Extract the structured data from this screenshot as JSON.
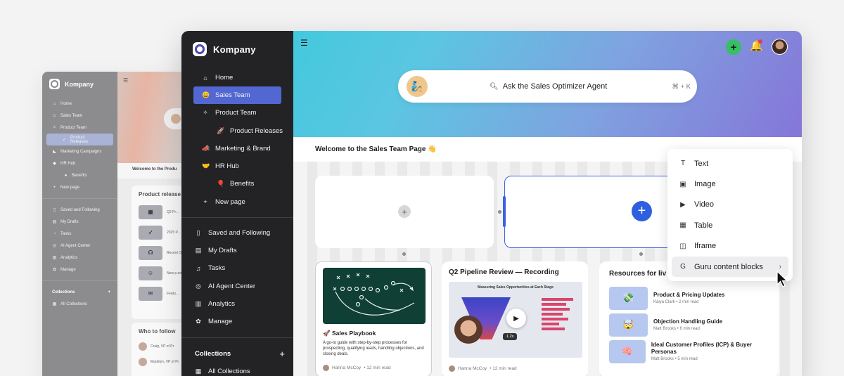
{
  "bg_window": {
    "brand": "Kompany",
    "nav": [
      {
        "icon": "⌂",
        "label": "Home",
        "sub": false,
        "active": false
      },
      {
        "icon": "☺",
        "label": "Sales Team",
        "sub": false,
        "active": false
      },
      {
        "icon": "✧",
        "label": "Product Team",
        "sub": false,
        "active": false
      },
      {
        "icon": "➶",
        "label": "Product Releases",
        "sub": true,
        "active": true
      },
      {
        "icon": "◣",
        "label": "Marketing Campaigns",
        "sub": false,
        "active": false
      },
      {
        "icon": "◆",
        "label": "HR Hub",
        "sub": false,
        "active": false
      },
      {
        "icon": "●",
        "label": "Benefits",
        "sub": true,
        "active": false
      },
      {
        "icon": "+",
        "label": "New page",
        "sub": false,
        "active": false
      }
    ],
    "nav2": [
      {
        "icon": "▯",
        "label": "Saved and Following"
      },
      {
        "icon": "▤",
        "label": "My Drafts"
      },
      {
        "icon": "◔",
        "label": "Tasks"
      },
      {
        "icon": "◎",
        "label": "AI Agent Center"
      },
      {
        "icon": "▥",
        "label": "Analytics"
      },
      {
        "icon": "✿",
        "label": "Manage"
      }
    ],
    "collections_label": "Collections",
    "all_collections": "All Collections",
    "welcome": "Welcome to the Produ",
    "card_title": "Product release",
    "card_rows": [
      {
        "icon": "▦",
        "text": "Q2 Pr..."
      },
      {
        "icon": "➶",
        "text": "2025 P..."
      },
      {
        "icon": "☊",
        "text": "Recent Overvie..."
      },
      {
        "icon": "☺",
        "text": "New p articl..."
      },
      {
        "icon": "✉",
        "text": "Featu..."
      }
    ],
    "follow_title": "Who to follow",
    "people": [
      {
        "name": "Craig,",
        "role": "VP of Pr"
      },
      {
        "name": "Madelyn,",
        "role": "VP of Pr"
      }
    ]
  },
  "sidebar": {
    "brand": "Kompany",
    "nav": [
      {
        "icon": "⌂",
        "label": "Home",
        "sub": false,
        "active": false
      },
      {
        "icon": "😀",
        "label": "Sales Team",
        "sub": false,
        "active": true
      },
      {
        "icon": "✧",
        "label": "Product Team",
        "sub": false,
        "active": false
      },
      {
        "icon": "🚀",
        "label": "Product Releases",
        "sub": true,
        "active": false
      },
      {
        "icon": "📣",
        "label": "Marketing & Brand",
        "sub": false,
        "active": false
      },
      {
        "icon": "🤝",
        "label": "HR Hub",
        "sub": false,
        "active": false
      },
      {
        "icon": "🎈",
        "label": "Benefits",
        "sub": true,
        "active": false
      },
      {
        "icon": "+",
        "label": "New page",
        "sub": false,
        "active": false
      }
    ],
    "nav2": [
      {
        "icon": "▯",
        "label": "Saved and Following"
      },
      {
        "icon": "▤",
        "label": "My Drafts"
      },
      {
        "icon": "♫",
        "label": "Tasks"
      },
      {
        "icon": "◎",
        "label": "AI Agent Center"
      },
      {
        "icon": "▥",
        "label": "Analytics"
      },
      {
        "icon": "✿",
        "label": "Manage"
      }
    ],
    "collections_label": "Collections",
    "all_collections": "All Collections"
  },
  "header": {
    "search_placeholder": "Ask the Sales Optimizer Agent",
    "shortcut": "⌘ + K",
    "accent_color": "#2d5fe0"
  },
  "page": {
    "welcome": "Welcome to the Sales Team Page 👋"
  },
  "cards": {
    "playbook": {
      "title": "🚀 Sales Playbook",
      "desc": "A go-to guide with step-by-step processes for prospecting, qualifying leads, handling objections, and closing deals.",
      "author": "Hanna McCoy",
      "read": "• 12 min read"
    },
    "pipeline": {
      "title": "Q2 Pipeline Review — Recording",
      "video_heading": "Measuring Sales Opportunities at Each Stage",
      "speed": "1.2x",
      "author": "Hanna McCoy",
      "read": "• 12 min read"
    },
    "resources": {
      "title": "Resources for liv",
      "items": [
        {
          "icon": "💸",
          "title": "Product & Pricing Updates",
          "meta": "Kaiya Clark • 2 min read"
        },
        {
          "icon": "🤯",
          "title": "Objection Handling Guide",
          "meta": "Matt Brooks • 6 min read"
        },
        {
          "icon": "🧠",
          "title": "Ideal Customer Profiles (ICP) & Buyer Personas",
          "meta": "Matt Brooks • 5 min read"
        }
      ]
    }
  },
  "insert_menu": {
    "items": [
      {
        "icon": "T",
        "label": "Text",
        "name": "text"
      },
      {
        "icon": "▣",
        "label": "Image",
        "name": "image"
      },
      {
        "icon": "▶",
        "label": "Video",
        "name": "video"
      },
      {
        "icon": "▦",
        "label": "Table",
        "name": "table"
      },
      {
        "icon": "◫",
        "label": "Iframe",
        "name": "iframe"
      },
      {
        "icon": "G",
        "label": "Guru content blocks",
        "name": "guru-content-blocks",
        "chevron": "›",
        "hover": true
      }
    ]
  }
}
